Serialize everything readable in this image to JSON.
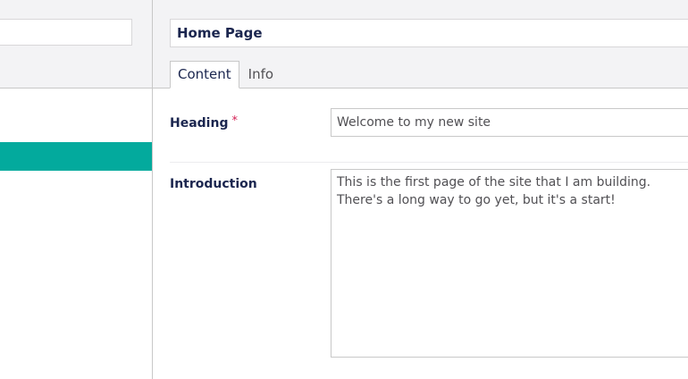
{
  "tree": {
    "search_value": "",
    "selected_item_color": "#03aa9d"
  },
  "editor": {
    "node_name": "Home Page",
    "tabs": [
      {
        "label": "Content",
        "active": true
      },
      {
        "label": "Info",
        "active": false
      }
    ],
    "properties": {
      "heading": {
        "label": "Heading",
        "required_marker": "*",
        "value": "Welcome to my new site"
      },
      "introduction": {
        "label": "Introduction",
        "value": "This is the first page of the site that I am building. There's a long way to go yet, but it's a start!"
      }
    }
  },
  "colors": {
    "accent": "#03aa9d",
    "required": "#d42054",
    "header_bg": "#f3f3f5"
  }
}
